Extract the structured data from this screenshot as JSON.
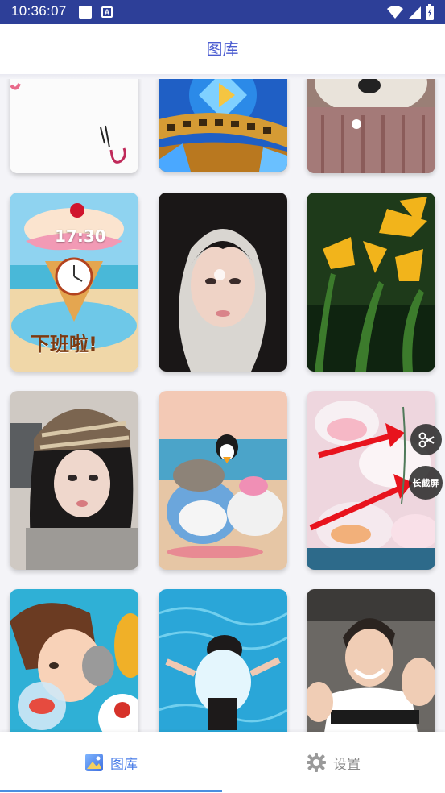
{
  "status_bar": {
    "time": "10:36:07"
  },
  "header": {
    "title": "图库"
  },
  "gallery": {
    "tile_texts": {
      "clock_time": "17:30",
      "off_work": "下班啦!"
    }
  },
  "floating": {
    "long_screenshot_label": "长截屏"
  },
  "bottom_nav": {
    "tabs": [
      {
        "label": "图库",
        "icon": "gallery-icon",
        "active": true
      },
      {
        "label": "设置",
        "icon": "gear-icon",
        "active": false
      }
    ]
  },
  "colors": {
    "status_bar": "#2d3f98",
    "accent": "#4a5bd0",
    "indicator": "#4a8fe0"
  }
}
